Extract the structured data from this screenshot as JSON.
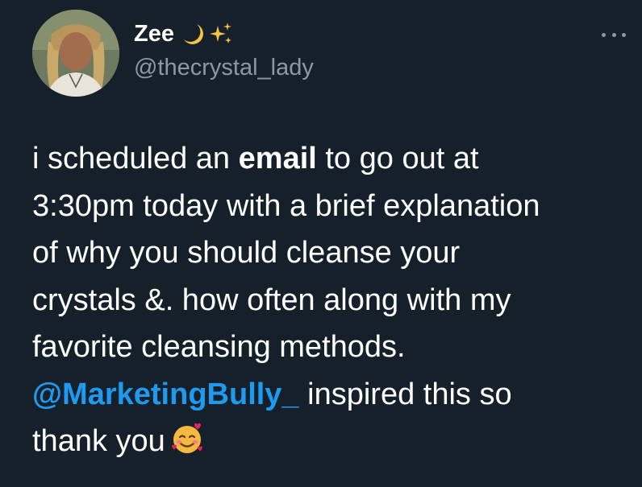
{
  "author": {
    "display_name": "Zee",
    "name_emojis": [
      "crescent-moon",
      "sparkles"
    ],
    "handle": "@thecrystal_lady"
  },
  "tweet": {
    "line1_pre": "i scheduled an ",
    "line1_bold": "email",
    "line1_post": " to go out at",
    "line2": "3:30pm today with a brief explanation",
    "line3": "of why you should cleanse your",
    "line4": "crystals &. how often along with my",
    "line5": "favorite cleansing methods.",
    "mention": "@MarketingBully_",
    "line6_post": " inspired this so",
    "line7": "thank you",
    "end_emoji": "smiling-face-with-hearts"
  },
  "colors": {
    "background": "#15202b",
    "text": "#ffffff",
    "secondary_text": "#8b98a5",
    "link": "#1d9bf0"
  }
}
